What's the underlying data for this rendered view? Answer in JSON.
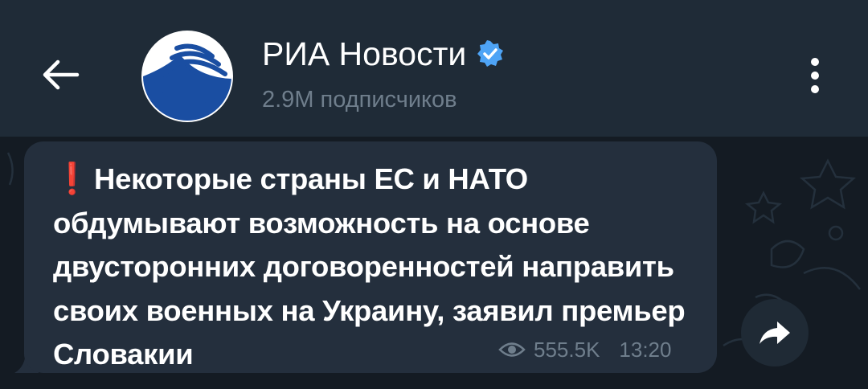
{
  "header": {
    "back_icon": "arrow-left-icon",
    "channel_name": "РИА Новости",
    "verified_icon": "verified-badge-icon",
    "subscribers": "2.9M подписчиков",
    "menu_icon": "more-vertical-icon"
  },
  "post": {
    "alert_icon": "❗",
    "text": "Некоторые страны ЕС и НАТО обдумывают возможность на основе двусторонних договоренностей направить своих военных на Украину, заявил премьер Словакии",
    "views": "555.5K",
    "time": "13:20",
    "share_icon": "share-arrow-icon"
  },
  "colors": {
    "header_bg": "#1f2b37",
    "chat_bg": "#141b23",
    "bubble_bg": "#242f3d",
    "accent": "#4ea4f6",
    "alert": "#e0312f",
    "muted_text": "#6f7e8c"
  }
}
